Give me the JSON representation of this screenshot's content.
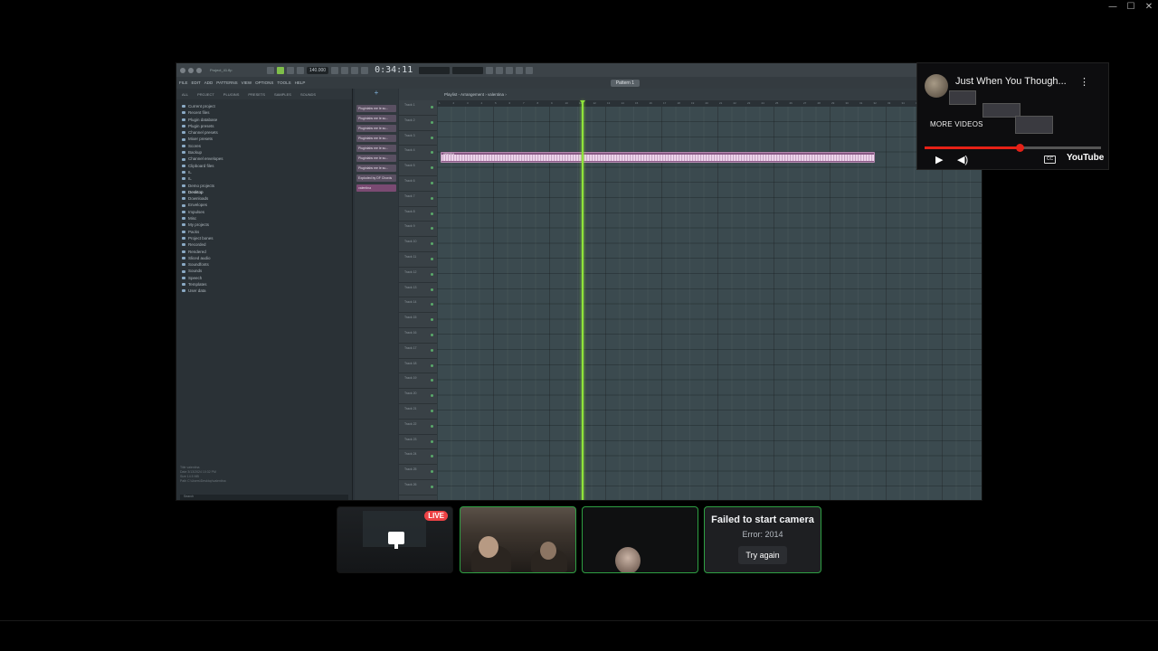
{
  "window_controls": {
    "minimize": "—",
    "maximize": "☐",
    "close": "✕"
  },
  "daw": {
    "title_filename": "Project_41.flp",
    "hint_text": "Song / pattern mode",
    "tempo": "140.000",
    "time_display": "0:34:11",
    "menu": [
      "FILE",
      "EDIT",
      "ADD",
      "PATTERNS",
      "VIEW",
      "OPTIONS",
      "TOOLS",
      "HELP"
    ],
    "pattern_label": "Pattern 1",
    "browser_tabs": [
      "ALL",
      "PROJECT",
      "PLUGINS",
      "PRESETS",
      "SAMPLES",
      "SOUNDS"
    ],
    "browser_items": [
      "Current project",
      "Recent files",
      "Plugin database",
      "Plugin presets",
      "Channel presets",
      "Mixer presets",
      "Scores",
      "Backup",
      "Channel envelopes",
      "Clipboard files",
      "IL",
      "IL",
      "Demo projects",
      "Desktop",
      "Downloads",
      "Envelopes",
      "Impulses",
      "Misc",
      "My projects",
      "Packs",
      "Project bones",
      "Recorded",
      "Rendered",
      "Sliced audio",
      "Soundfonts",
      "Sounds",
      "Speech",
      "Templates",
      "User data"
    ],
    "browser_selected": "Desktop",
    "browser_footer": [
      "Title  valentina",
      "Date  3/13/2024 10:32 PM",
      "Size  14.5 MB",
      "Path  C:\\Users\\Desktop\\valentina"
    ],
    "search_placeholder": "Search",
    "channels": [
      "Pluginlabs me le su...",
      "Pluginlabs me le su...",
      "Pluginlabs me le su...",
      "Pluginlabs me le su...",
      "Pluginlabs me le su...",
      "Pluginlabs me le su...",
      "Pluginlabs me le su...",
      "Exploded by DF Chords",
      "valentina"
    ],
    "playlist_title": "Playlist - Arrangement › valentina ›",
    "tracks": [
      "Track 1",
      "Track 2",
      "Track 3",
      "Track 4",
      "Track 5",
      "Track 6",
      "Track 7",
      "Track 8",
      "Track 9",
      "Track 10",
      "Track 11",
      "Track 12",
      "Track 13",
      "Track 14",
      "Track 15",
      "Track 16",
      "Track 17",
      "Track 18",
      "Track 19",
      "Track 20",
      "Track 21",
      "Track 22",
      "Track 23",
      "Track 24",
      "Track 25",
      "Track 26"
    ],
    "clip_label": "valentina",
    "ruler_marks": [
      "1",
      "2",
      "3",
      "4",
      "5",
      "6",
      "7",
      "8",
      "9",
      "10",
      "11",
      "12",
      "13",
      "14",
      "15",
      "16",
      "17",
      "18",
      "19",
      "20",
      "21",
      "22",
      "23",
      "24",
      "25",
      "26",
      "27",
      "28",
      "29",
      "30",
      "31",
      "32",
      "33",
      "34",
      "35",
      "36",
      "37",
      "38",
      "39",
      "40",
      "41"
    ]
  },
  "youtube": {
    "title": "Just When You Though...",
    "more_videos": "MORE VIDEOS",
    "brand": "YouTube",
    "progress": 0.54,
    "cc_label": "CC"
  },
  "call": {
    "live_badge": "LIVE",
    "camera_error": {
      "heading": "Failed to start camera",
      "error": "Error: 2014",
      "retry": "Try again"
    }
  },
  "colors": {
    "accent_green": "#2ea043",
    "live_red": "#ed4245",
    "playhead": "#8fe33a",
    "clip": "#8a5a86"
  }
}
